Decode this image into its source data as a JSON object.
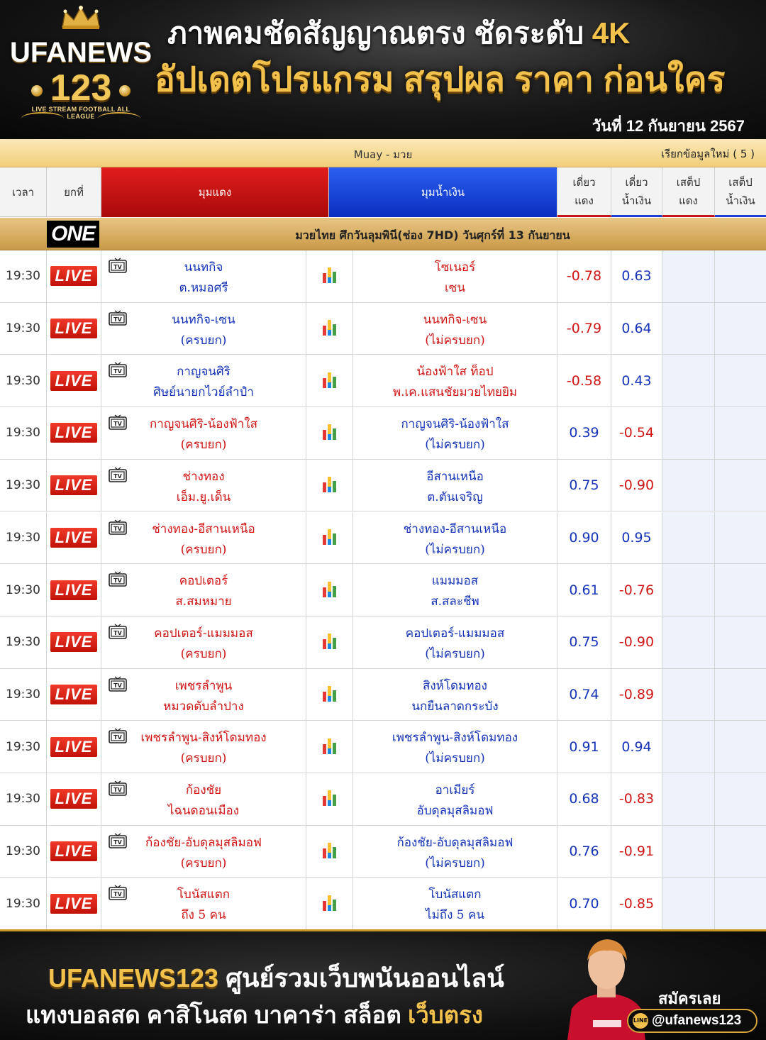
{
  "header": {
    "logo_brand": "UFANEWS",
    "logo_number": "123",
    "logo_tagline": "LIVE STREAM FOOTBALL ALL LEAGUE",
    "headline_main": "ภาพคมชัดสัญญาณตรง ชัดระดับ ",
    "headline_highlight": "4K",
    "headline_sub": "อัปเดตโปรแกรม สรุปผล ราคา ก่อนใคร",
    "date": "วันที่ 12 กันยายน 2567"
  },
  "sport_bar": {
    "title": "Muay - มวย",
    "refresh": "เรียกข้อมูลใหม่ ( 5 )"
  },
  "columns": {
    "time": "เวลา",
    "round": "ยกที่",
    "red_corner": "มุมแดง",
    "blue_corner": "มุมน้ำเงิน",
    "single_red_1": "เดี่ยว",
    "single_red_2": "แดง",
    "single_blue_1": "เดี่ยว",
    "single_blue_2": "น้ำเงิน",
    "step_red_1": "เสต็ป",
    "step_red_2": "แดง",
    "step_blue_1": "เสต็ป",
    "step_blue_2": "น้ำเงิน"
  },
  "league": {
    "logo_text": "ONE",
    "title": "มวยไทย ศึกวันลุมพินี(ช่อง 7HD) วันศุกร์ที่ 13 กันยายน"
  },
  "live_label": "LIVE",
  "matches": [
    {
      "time": "19:30",
      "home": [
        "นนทกิจ",
        "ต.หมอศรี"
      ],
      "away": [
        "โซเนอร์",
        "เซน"
      ],
      "odd_red": "-0.78",
      "odd_blue": "0.63",
      "home_color": "blue",
      "away_color": "red"
    },
    {
      "time": "19:30",
      "home": [
        "นนทกิจ-เซน",
        "(ครบยก)"
      ],
      "away": [
        "นนทกิจ-เซน",
        "(ไม่ครบยก)"
      ],
      "odd_red": "-0.79",
      "odd_blue": "0.64",
      "home_color": "blue",
      "away_color": "red"
    },
    {
      "time": "19:30",
      "home": [
        "กาญจนศิริ",
        "ศิษย์นายกไวย์ลำปำ"
      ],
      "away": [
        "น้องฟ้าใส ท็อป",
        "พ.เค.แสนชัยมวยไทยยิม"
      ],
      "odd_red": "-0.58",
      "odd_blue": "0.43",
      "home_color": "blue",
      "away_color": "red"
    },
    {
      "time": "19:30",
      "home": [
        "กาญจนศิริ-น้องฟ้าใส",
        "(ครบยก)"
      ],
      "away": [
        "กาญจนศิริ-น้องฟ้าใส",
        "(ไม่ครบยก)"
      ],
      "odd_red": "0.39",
      "odd_blue": "-0.54",
      "home_color": "red",
      "away_color": "blue"
    },
    {
      "time": "19:30",
      "home": [
        "ช่างทอง",
        "เอ็ม.ยู.เด็น"
      ],
      "away": [
        "อีสานเหนือ",
        "ต.ตันเจริญ"
      ],
      "odd_red": "0.75",
      "odd_blue": "-0.90",
      "home_color": "red",
      "away_color": "blue"
    },
    {
      "time": "19:30",
      "home": [
        "ช่างทอง-อีสานเหนือ",
        "(ครบยก)"
      ],
      "away": [
        "ช่างทอง-อีสานเหนือ",
        "(ไม่ครบยก)"
      ],
      "odd_red": "0.90",
      "odd_blue": "0.95",
      "home_color": "red",
      "away_color": "blue"
    },
    {
      "time": "19:30",
      "home": [
        "คอปเตอร์",
        "ส.สมหมาย"
      ],
      "away": [
        "แมมมอส",
        "ส.สละชีพ"
      ],
      "odd_red": "0.61",
      "odd_blue": "-0.76",
      "home_color": "red",
      "away_color": "blue"
    },
    {
      "time": "19:30",
      "home": [
        "คอปเตอร์-แมมมอส",
        "(ครบยก)"
      ],
      "away": [
        "คอปเตอร์-แมมมอส",
        "(ไม่ครบยก)"
      ],
      "odd_red": "0.75",
      "odd_blue": "-0.90",
      "home_color": "red",
      "away_color": "blue"
    },
    {
      "time": "19:30",
      "home": [
        "เพชรลำพูน",
        "หมวดตับลำปาง"
      ],
      "away": [
        "สิงห์โดมทอง",
        "นกยืนลาดกระบัง"
      ],
      "odd_red": "0.74",
      "odd_blue": "-0.89",
      "home_color": "red",
      "away_color": "blue"
    },
    {
      "time": "19:30",
      "home": [
        "เพชรลำพูน-สิงห์โดมทอง",
        "(ครบยก)"
      ],
      "away": [
        "เพชรลำพูน-สิงห์โดมทอง",
        "(ไม่ครบยก)"
      ],
      "odd_red": "0.91",
      "odd_blue": "0.94",
      "home_color": "red",
      "away_color": "blue"
    },
    {
      "time": "19:30",
      "home": [
        "ก้องชัย",
        "ไฉนดอนเมือง"
      ],
      "away": [
        "อาเมียร์",
        "อับดุลมุสลิมอฟ"
      ],
      "odd_red": "0.68",
      "odd_blue": "-0.83",
      "home_color": "red",
      "away_color": "blue"
    },
    {
      "time": "19:30",
      "home": [
        "ก้องชัย-อับดุลมุสลิมอฟ",
        "(ครบยก)"
      ],
      "away": [
        "ก้องชัย-อับดุลมุสลิมอฟ",
        "(ไม่ครบยก)"
      ],
      "odd_red": "0.76",
      "odd_blue": "-0.91",
      "home_color": "red",
      "away_color": "blue"
    },
    {
      "time": "19:30",
      "home": [
        "โบนัสแตก",
        "ถึง 5 คน"
      ],
      "away": [
        "โบนัสแตก",
        "ไม่ถึง 5 คน"
      ],
      "odd_red": "0.70",
      "odd_blue": "-0.85",
      "home_color": "red",
      "away_color": "blue"
    }
  ],
  "footer": {
    "brand": "UFANEWS123",
    "brand_tagline": "ศูนย์รวมเว็บพนันออนไลน์",
    "services": "แทงบอลสด คาสิโนสด บาคาร่า สล็อต ",
    "services_highlight": "เว็บตรง",
    "signup": "สมัครเลย",
    "line_icon": "LINE",
    "line_handle": "@ufanews123"
  },
  "colors": {
    "gold": "#f2c14b",
    "red_corner": "#c11208",
    "blue_corner": "#0b2fc0",
    "negative_odd": "#d01515",
    "positive_odd": "#1534b8"
  },
  "icons": [
    "crown-icon",
    "tv-icon",
    "stats-bar-icon",
    "line-icon"
  ]
}
